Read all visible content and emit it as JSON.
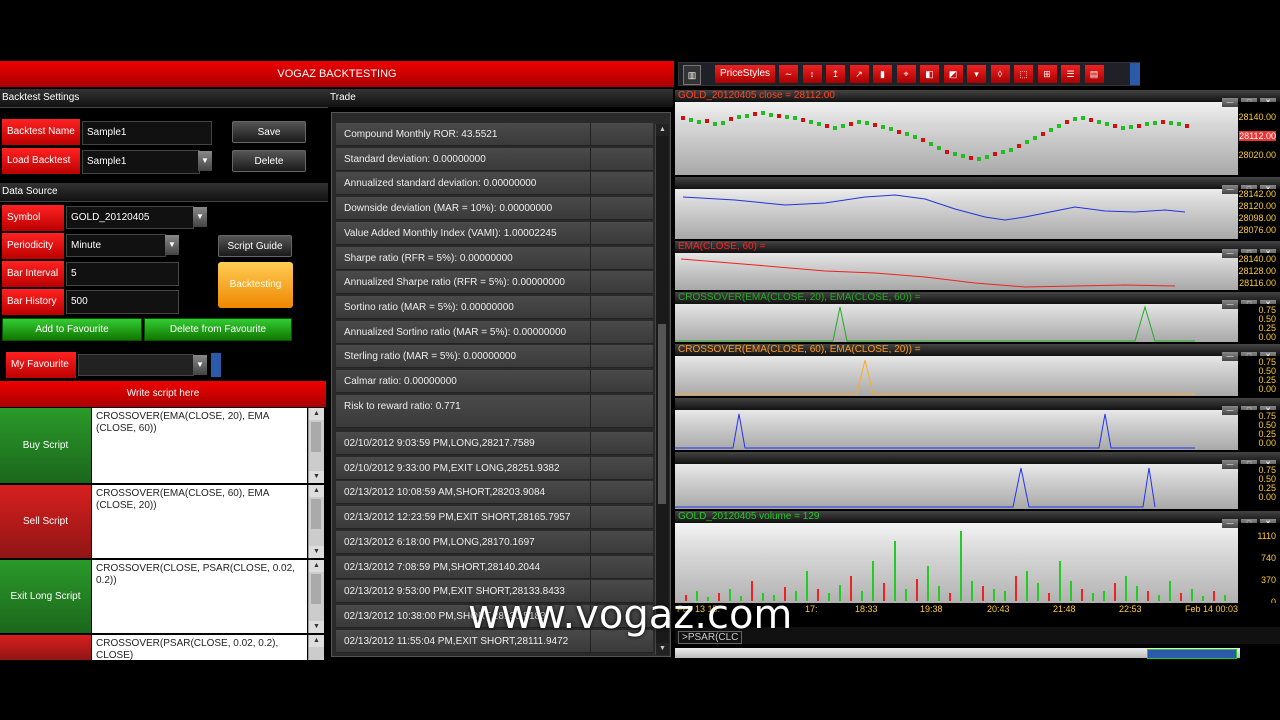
{
  "app": {
    "title": "VOGAZ  BACKTESTING"
  },
  "backtest_settings": {
    "header": "Backtest Settings",
    "name_label": "Backtest Name",
    "name_value": "Sample1",
    "save_label": "Save",
    "load_label": "Load Backtest",
    "load_value": "Sample1",
    "delete_label": "Delete"
  },
  "data_source": {
    "header": "Data Source",
    "symbol_label": "Symbol",
    "symbol_value": "GOLD_20120405",
    "periodicity_label": "Periodicity",
    "periodicity_value": "Minute",
    "script_guide_label": "Script Guide",
    "bar_interval_label": "Bar Interval",
    "bar_interval_value": "5",
    "backtesting_label": "Backtesting",
    "bar_history_label": "Bar History",
    "bar_history_value": "500",
    "add_favourite_label": "Add to Favourite",
    "delete_favourite_label": "Delete from Favourite",
    "my_favourite_label": "My Favourite"
  },
  "scripts": {
    "header": "Write script here",
    "items": [
      {
        "label": "Buy Script",
        "text": "CROSSOVER(EMA(CLOSE, 20), EMA (CLOSE, 60))",
        "color": "#2a9a2a"
      },
      {
        "label": "Sell Script",
        "text": "CROSSOVER(EMA(CLOSE, 60), EMA (CLOSE, 20))",
        "color": "#d81f1f"
      },
      {
        "label": "Exit Long Script",
        "text": "CROSSOVER(CLOSE, PSAR(CLOSE, 0.02, 0.2))",
        "color": "#2a9a2a"
      },
      {
        "label": "",
        "text": "CROSSOVER(PSAR(CLOSE, 0.02, 0.2), CLOSE)",
        "color": "#d81f1f"
      }
    ]
  },
  "trade": {
    "header": "Trade",
    "stats": [
      "Compound Monthly ROR: 43.5521",
      "Standard deviation: 0.00000000",
      "Annualized standard deviation: 0.00000000",
      "Downside deviation (MAR = 10%): 0.00000000",
      "Value Added Monthly Index (VAMI): 1.00002245",
      "Sharpe ratio (RFR = 5%): 0.00000000",
      "Annualized Sharpe ratio (RFR = 5%): 0.00000000",
      "Sortino ratio (MAR = 5%): 0.00000000",
      "Annualized Sortino ratio (MAR = 5%): 0.00000000",
      "Sterling ratio (MAR = 5%): 0.00000000",
      "Calmar ratio: 0.00000000",
      "Risk to reward ratio: 0.771"
    ],
    "trades": [
      "02/10/2012 9:03:59 PM,LONG,28217.7589",
      "02/10/2012 9:33:00 PM,EXIT LONG,28251.9382",
      "02/13/2012 10:08:59 AM,SHORT,28203.9084",
      "02/13/2012 12:23:59 PM,EXIT SHORT,28165.7957",
      "02/13/2012 6:18:00 PM,LONG,28170.1697",
      "02/13/2012 7:08:59 PM,SHORT,28140.2044",
      "02/13/2012 9:53:00 PM,EXIT SHORT,28133.8433",
      "02/13/2012 10:38:00 PM,SHORT,28130.5183",
      "02/13/2012 11:55:04 PM,EXIT SHORT,28111.9472"
    ]
  },
  "toolbar": {
    "price_styles_label": "PriceStyles"
  },
  "charts": {
    "price": {
      "title": "GOLD_20120405 close = 28112.00",
      "y_labels": [
        "28140.00",
        "28112.00",
        "28020.00"
      ]
    },
    "sma": {
      "title": "",
      "y_labels": [
        "28142.00",
        "28120.00",
        "28098.00",
        "28076.00"
      ]
    },
    "ema": {
      "title": "EMA(CLOSE, 60) =",
      "y_labels": [
        "28140.00",
        "28128.00",
        "28116.00"
      ]
    },
    "cross1": {
      "title": "CROSSOVER(EMA(CLOSE, 20), EMA(CLOSE, 60)) =",
      "y_labels": [
        "0.75",
        "0.50",
        "0.25",
        "0.00"
      ]
    },
    "cross2": {
      "title": "CROSSOVER(EMA(CLOSE, 60), EMA(CLOSE, 20)) =",
      "y_labels": [
        "0.75",
        "0.50",
        "0.25",
        "0.00"
      ]
    },
    "cross3": {
      "title": "",
      "y_labels": [
        "0.75",
        "0.50",
        "0.25",
        "0.00"
      ]
    },
    "cross4": {
      "title": "",
      "y_labels": [
        "0.75",
        "0.50",
        "0.25",
        "0.00"
      ]
    },
    "volume": {
      "title": "GOLD_20120405 volume = 129",
      "y_labels": [
        "1110",
        "740",
        "370",
        "0"
      ],
      "x_labels": [
        "Feb 13 15:",
        "17:",
        "18:33",
        "19:38",
        "20:43",
        "21:48",
        "22:53",
        "Feb 14 00:03"
      ]
    },
    "psar_tab": ">PSAR(CLC"
  },
  "watermark": "www.vogaz.com"
}
